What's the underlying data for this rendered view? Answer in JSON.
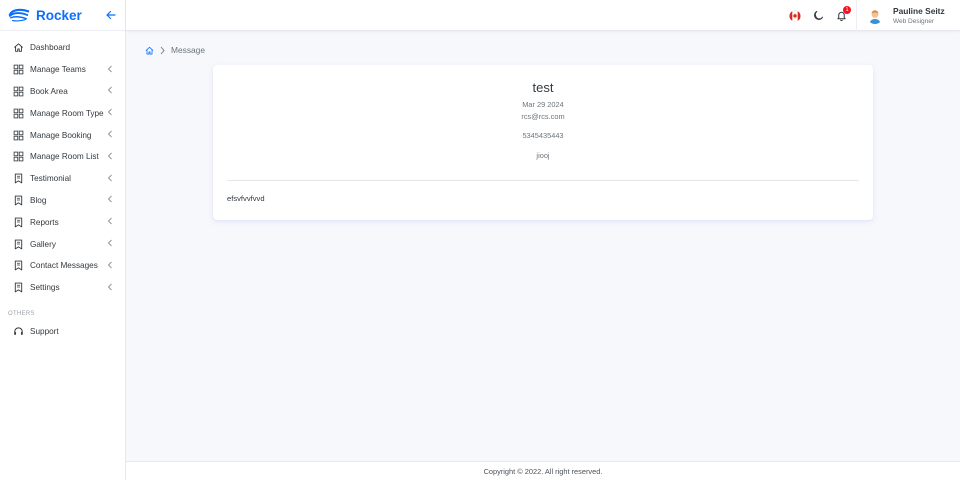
{
  "brand": {
    "name": "Rocker",
    "accent": "#0d6efd"
  },
  "sidebar": {
    "items": [
      {
        "label": "Dashboard",
        "icon": "home-icon",
        "chevron": false
      },
      {
        "label": "Manage Teams",
        "icon": "grid-icon",
        "chevron": true
      },
      {
        "label": "Book Area",
        "icon": "grid-icon",
        "chevron": true
      },
      {
        "label": "Manage Room Type",
        "icon": "grid-icon",
        "chevron": true
      },
      {
        "label": "Manage Booking",
        "icon": "grid-icon",
        "chevron": true
      },
      {
        "label": "Manage Room List",
        "icon": "grid-icon",
        "chevron": true
      },
      {
        "label": "Testimonial",
        "icon": "bookmark-icon",
        "chevron": true
      },
      {
        "label": "Blog",
        "icon": "bookmark-icon",
        "chevron": true
      },
      {
        "label": "Reports",
        "icon": "bookmark-icon",
        "chevron": true
      },
      {
        "label": "Gallery",
        "icon": "bookmark-icon",
        "chevron": true
      },
      {
        "label": "Contact Messages",
        "icon": "bookmark-icon",
        "chevron": true
      },
      {
        "label": "Settings",
        "icon": "bookmark-icon",
        "chevron": true
      }
    ],
    "section_label": "OTHERS",
    "support_label": "Support"
  },
  "topbar": {
    "flag_icon": "canada-flag-icon",
    "notification_count": "1",
    "user": {
      "name": "Pauline Seitz",
      "role": "Web Designer"
    }
  },
  "breadcrumb": {
    "current": "Message"
  },
  "message": {
    "name": "test",
    "date": "Mar 29 2024",
    "email": "rcs@rcs.com",
    "phone": "5345435443",
    "subject": "jiooj",
    "body": "efsvfvvfvvd"
  },
  "footer": {
    "text": "Copyright © 2022. All right reserved."
  }
}
